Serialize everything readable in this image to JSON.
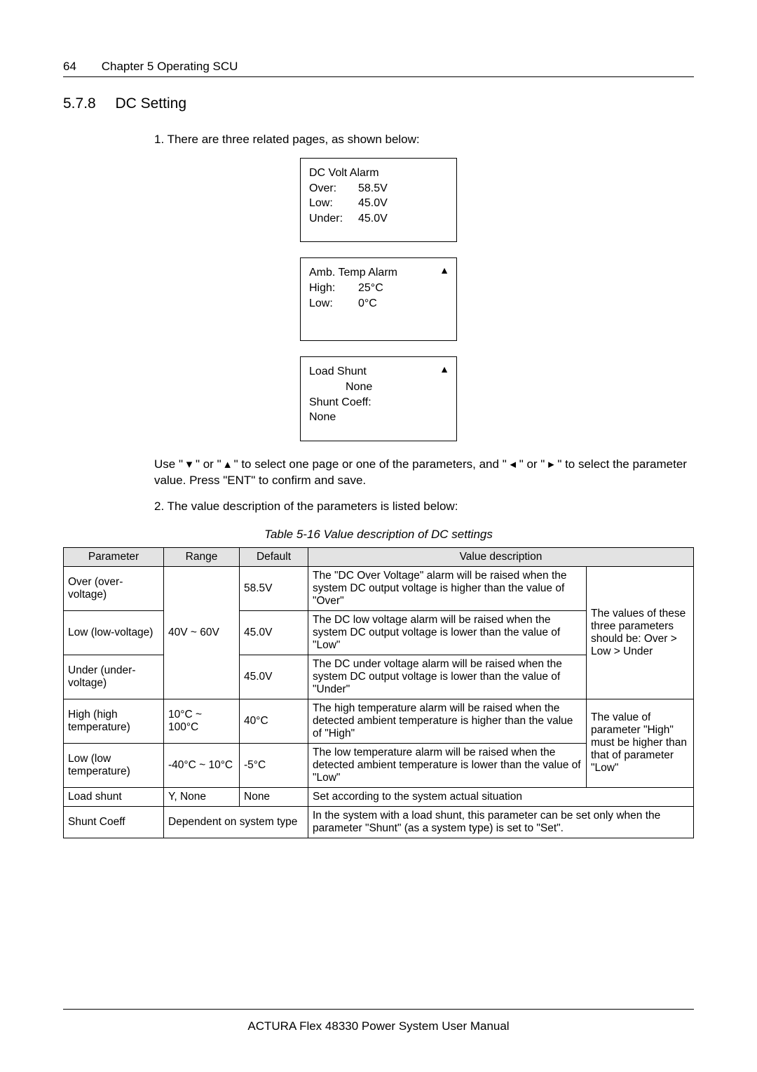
{
  "header": {
    "page_number": "64",
    "chapter": "Chapter 5    Operating SCU"
  },
  "section": {
    "number": "5.7.8",
    "title": "DC Setting"
  },
  "intro_1": "1. There are three related pages, as shown below:",
  "display1": {
    "title": "DC Volt Alarm",
    "rows": [
      {
        "label": "Over:",
        "value": "58.5V"
      },
      {
        "label": "Low:",
        "value": "45.0V"
      },
      {
        "label": "Under:",
        "value": "45.0V"
      }
    ]
  },
  "display2": {
    "title": "Amb. Temp Alarm",
    "up_marker": "▲",
    "rows": [
      {
        "label": "High:",
        "value": "25°C"
      },
      {
        "label": "Low:",
        "value": "0°C"
      }
    ]
  },
  "display3": {
    "line1": "Load Shunt",
    "up_marker": "▲",
    "line2": "None",
    "line3": "Shunt Coeff:",
    "line4": "None"
  },
  "nav_text": "Use \" ▾ \" or \" ▴ \" to select one page or one of the parameters, and \" ◂ \" or \" ▸ \" to select the parameter value. Press \"ENT\" to confirm and save.",
  "intro_2": "2. The value description of the parameters is listed below:",
  "table_caption": "Table 5-16    Value description of DC settings",
  "table": {
    "headers": [
      "Parameter",
      "Range",
      "Default",
      "Value description"
    ],
    "note_group1": "The values of these three parameters should be: Over > Low > Under",
    "note_group2": "The value of parameter \"High\" must be higher than that of parameter \"Low\"",
    "rows": [
      {
        "param": "Over (over-voltage)",
        "range": "40V ~ 60V",
        "default": "58.5V",
        "desc": "The \"DC Over Voltage\" alarm will be raised when the system DC output voltage is higher than the value of \"Over\""
      },
      {
        "param": "Low (low-voltage)",
        "default": "45.0V",
        "desc": "The DC low voltage alarm will be raised when the system DC output voltage is lower than the value of \"Low\""
      },
      {
        "param": "Under (under-voltage)",
        "default": "45.0V",
        "desc": "The DC under voltage alarm will be raised when the system DC output voltage is lower than the value of \"Under\""
      },
      {
        "param": "High (high temperature)",
        "range": "10°C ~ 100°C",
        "default": "40°C",
        "desc": "The high temperature alarm will be raised when the detected ambient temperature is higher than the value of \"High\""
      },
      {
        "param": "Low (low temperature)",
        "range": "-40°C ~ 10°C",
        "default": "-5°C",
        "desc": "The low temperature alarm will be raised when the detected ambient temperature is lower than the value of \"Low\""
      },
      {
        "param": "Load shunt",
        "range": "Y, None",
        "default": "None",
        "desc": "Set according to the system actual situation"
      },
      {
        "param": "Shunt Coeff",
        "range_default": "Dependent on system type",
        "desc": "In the system with a load shunt, this parameter can be set only when the parameter \"Shunt\" (as a system type) is set to \"Set\"."
      }
    ]
  },
  "footer": "ACTURA Flex 48330 Power System    User Manual"
}
